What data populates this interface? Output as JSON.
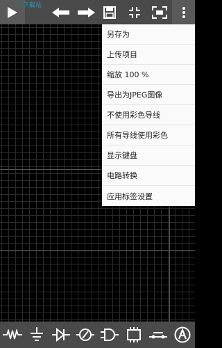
{
  "toolbar": {
    "watermark": "下载站",
    "icons": [
      "play-icon",
      "undo-icon",
      "redo-icon",
      "save-icon",
      "shrink-icon",
      "fit-screen-icon",
      "more-vert-icon"
    ]
  },
  "menu": {
    "items": [
      {
        "label": "另存为"
      },
      {
        "label": "上传项目"
      },
      {
        "label": "缩放 100 %"
      },
      {
        "label": "导出为JPEG图像"
      },
      {
        "label": "不使用彩色导线"
      },
      {
        "label": "所有导线使用彩色"
      },
      {
        "label": "显示键盘"
      },
      {
        "label": "电路转换"
      },
      {
        "label": "应用标签设置"
      }
    ]
  },
  "bottombar": {
    "icons": [
      "resistor-icon",
      "ground-icon",
      "diode-icon",
      "probe-icon",
      "and-gate-icon",
      "chip-icon",
      "switch-icon",
      "label-a-icon"
    ]
  },
  "colors": {
    "toolbar": "#4a4a4a",
    "icon": "#ffffff",
    "menu_bg": "#fafafa",
    "grid": "#2b2b2b",
    "canvas": "#000000"
  }
}
